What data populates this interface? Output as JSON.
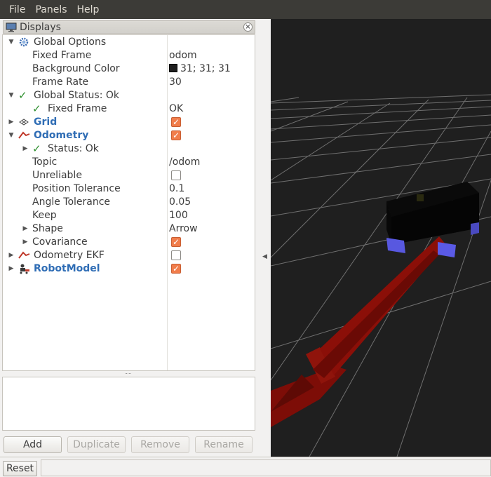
{
  "menu": {
    "file": "File",
    "panels": "Panels",
    "help": "Help"
  },
  "panel": {
    "title": "Displays",
    "close_glyph": "×"
  },
  "tree": {
    "global_options": "Global Options",
    "fixed_frame_label": "Fixed Frame",
    "fixed_frame_value": "odom",
    "background_color_label": "Background Color",
    "background_color_value": "31; 31; 31",
    "frame_rate_label": "Frame Rate",
    "frame_rate_value": "30",
    "global_status": "Global Status: Ok",
    "status_fixed_frame_label": "Fixed Frame",
    "status_fixed_frame_value": "OK",
    "grid": "Grid",
    "odometry": "Odometry",
    "status_ok": "Status: Ok",
    "topic_label": "Topic",
    "topic_value": "/odom",
    "unreliable_label": "Unreliable",
    "position_tolerance_label": "Position Tolerance",
    "position_tolerance_value": "0.1",
    "angle_tolerance_label": "Angle Tolerance",
    "angle_tolerance_value": "0.05",
    "keep_label": "Keep",
    "keep_value": "100",
    "shape_label": "Shape",
    "shape_value": "Arrow",
    "covariance_label": "Covariance",
    "odometry_ekf": "Odometry EKF",
    "robot_model": "RobotModel"
  },
  "buttons": {
    "add": "Add",
    "duplicate": "Duplicate",
    "remove": "Remove",
    "rename": "Rename",
    "reset": "Reset"
  },
  "colors": {
    "background": "#1f1f1f",
    "grid": "#a0a0a0",
    "arrow": "#8b0f08",
    "robot_body": "#050505",
    "wheels": "#5a5ae0",
    "link": "#2f6db5",
    "checkbox": "#f17d4b"
  },
  "icons": {
    "panel": "monitor-icon",
    "global_options": "gear-icon",
    "status": "check-icon",
    "grid": "grid-icon",
    "odometry": "odometry-icon",
    "robot_model": "robot-icon"
  }
}
